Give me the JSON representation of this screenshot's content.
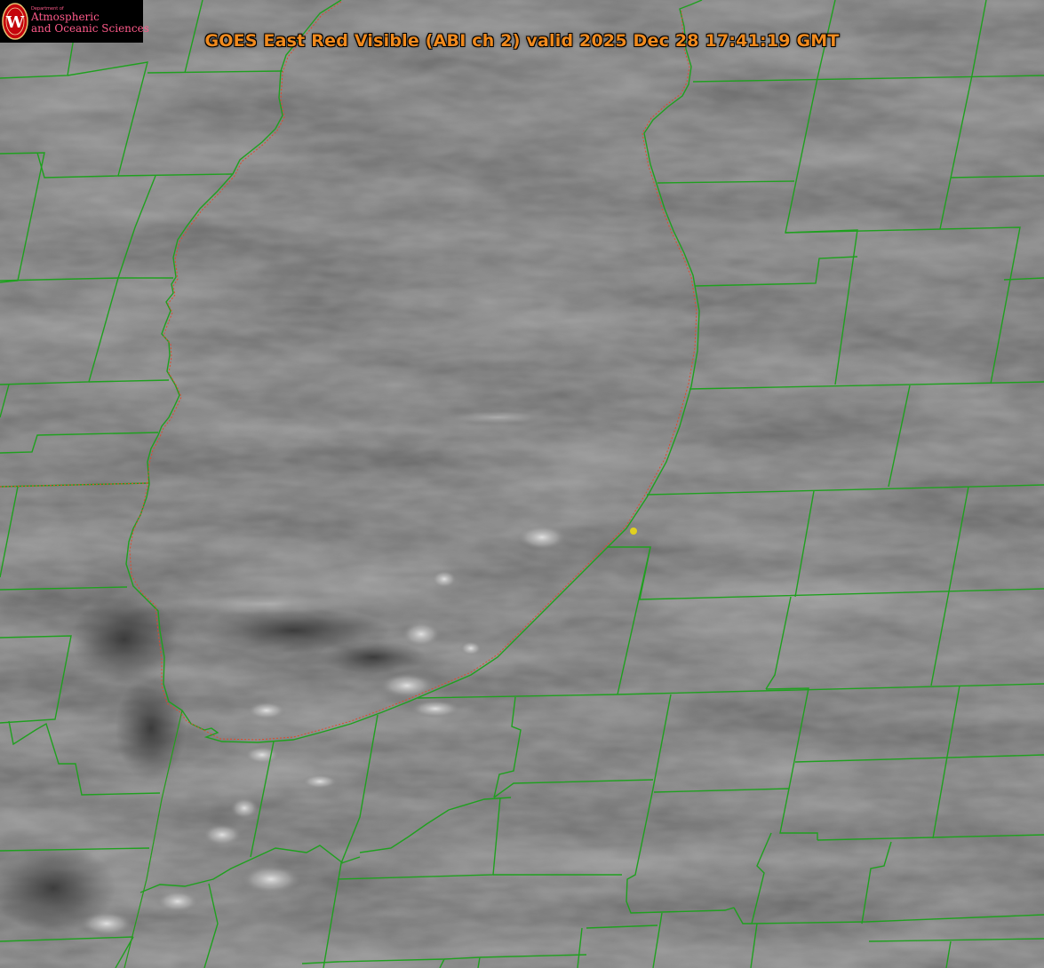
{
  "title": "GOES East Red Visible (ABI ch 2) valid 2025 Dec 28 17:41:19 GMT",
  "logo": {
    "department_small": "Department of",
    "line1": "Atmospheric",
    "line2": "and Oceanic Sciences",
    "seal_letter": "W",
    "seal_icon": "uw-seal-icon"
  },
  "colors": {
    "title": "#f08a1e",
    "county_borders": "#1fa01f",
    "state_border": "#e04a2a",
    "marker": "#e0d020",
    "logo_text": "#ff5a8a",
    "logo_seal": "#c5050c"
  },
  "map": {
    "imagery": "grayscale visible satellite cloud field",
    "overlays": [
      "county-borders",
      "lake-michigan-shoreline",
      "state-border-dotted",
      "station-marker"
    ]
  }
}
